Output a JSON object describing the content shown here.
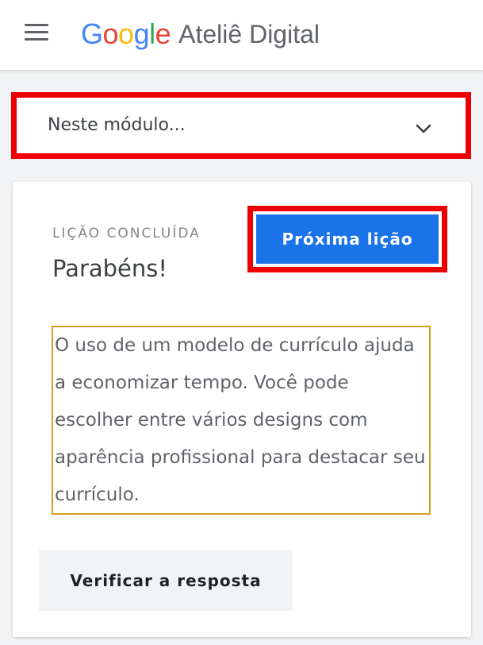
{
  "header": {
    "logo_letters": [
      {
        "char": "G",
        "color": "#4285f4"
      },
      {
        "char": "o",
        "color": "#ea4335"
      },
      {
        "char": "o",
        "color": "#fbbc05"
      },
      {
        "char": "g",
        "color": "#4285f4"
      },
      {
        "char": "l",
        "color": "#34a853"
      },
      {
        "char": "e",
        "color": "#ea4335"
      }
    ],
    "brand_suffix": "Ateliê Digital",
    "menu_icon": "hamburger-menu-icon"
  },
  "module_selector": {
    "label": "Neste módulo...",
    "icon": "chevron-down-icon"
  },
  "lesson": {
    "status": "LIÇÃO CONCLUÍDA",
    "title": "Parabéns!",
    "next_label": "Próxima lição",
    "text": "O uso de um modelo de currículo ajuda a economizar tempo. Você pode escolher entre vários designs com aparência profissional para destacar seu currículo.",
    "check_label": "Verificar a resposta"
  },
  "colors": {
    "primary": "#1a73e8",
    "highlight_border": "#ee0000",
    "text_box_border": "#d4a01c"
  }
}
